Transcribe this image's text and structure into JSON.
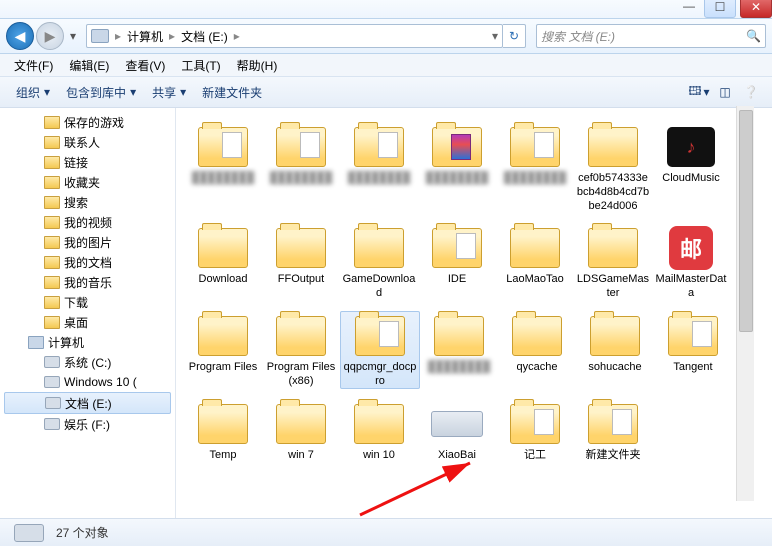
{
  "titlebar": {
    "min": "—",
    "max": "☐",
    "close": "✕"
  },
  "nav": {
    "crumbs": [
      "计算机",
      "文档 (E:)"
    ],
    "search_placeholder": "搜索 文档 (E:)"
  },
  "menubar": [
    "文件(F)",
    "编辑(E)",
    "查看(V)",
    "工具(T)",
    "帮助(H)"
  ],
  "toolbar": {
    "organize": "组织",
    "include": "包含到库中",
    "share": "共享",
    "newfolder": "新建文件夹"
  },
  "sidebar": {
    "items": [
      {
        "label": "保存的游戏",
        "kind": "folder",
        "level": 1
      },
      {
        "label": "联系人",
        "kind": "folder",
        "level": 1
      },
      {
        "label": "链接",
        "kind": "folder",
        "level": 1
      },
      {
        "label": "收藏夹",
        "kind": "folder",
        "level": 1
      },
      {
        "label": "搜索",
        "kind": "folder",
        "level": 1
      },
      {
        "label": "我的视频",
        "kind": "folder",
        "level": 1
      },
      {
        "label": "我的图片",
        "kind": "folder",
        "level": 1
      },
      {
        "label": "我的文档",
        "kind": "folder",
        "level": 1
      },
      {
        "label": "我的音乐",
        "kind": "folder",
        "level": 1
      },
      {
        "label": "下载",
        "kind": "folder",
        "level": 1
      },
      {
        "label": "桌面",
        "kind": "folder",
        "level": 1
      },
      {
        "label": "计算机",
        "kind": "computer",
        "level": 0
      },
      {
        "label": "系统 (C:)",
        "kind": "drive",
        "level": 1
      },
      {
        "label": "Windows 10 (",
        "kind": "drive",
        "level": 1
      },
      {
        "label": "文档 (E:)",
        "kind": "drive",
        "level": 1,
        "selected": true
      },
      {
        "label": "娱乐 (F:)",
        "kind": "drive",
        "level": 1
      }
    ]
  },
  "files": [
    {
      "kind": "folder-doc",
      "blur": true,
      "name": ""
    },
    {
      "kind": "folder-doc",
      "blur": true,
      "name": ""
    },
    {
      "kind": "folder-doc",
      "blur": true,
      "name": ""
    },
    {
      "kind": "folder-rar",
      "blur": true,
      "name": ""
    },
    {
      "kind": "folder-doc",
      "blur": true,
      "name": ""
    },
    {
      "kind": "folder",
      "name": "cef0b574333ebcb4d8b4cd7bbe24d006"
    },
    {
      "kind": "app-cloud",
      "name": "CloudMusic"
    },
    {
      "kind": "folder",
      "name": "Download"
    },
    {
      "kind": "folder",
      "name": "FFOutput"
    },
    {
      "kind": "folder",
      "name": "GameDownload"
    },
    {
      "kind": "folder-doc",
      "name": "IDE"
    },
    {
      "kind": "folder",
      "name": "LaoMaoTao"
    },
    {
      "kind": "folder",
      "name": "LDSGameMaster"
    },
    {
      "kind": "app-mail",
      "name": "MailMasterData"
    },
    {
      "kind": "folder",
      "name": "Program Files"
    },
    {
      "kind": "folder",
      "name": "Program Files (x86)"
    },
    {
      "kind": "folder-doc",
      "name": "qqpcmgr_docpro",
      "selected": true
    },
    {
      "kind": "folder",
      "blur": true,
      "name": ""
    },
    {
      "kind": "folder",
      "name": "qycache"
    },
    {
      "kind": "folder",
      "name": "sohucache"
    },
    {
      "kind": "folder-doc",
      "name": "Tangent"
    },
    {
      "kind": "folder",
      "name": "Temp"
    },
    {
      "kind": "folder",
      "name": "win 7"
    },
    {
      "kind": "folder",
      "name": "win 10"
    },
    {
      "kind": "disk",
      "name": "XiaoBai"
    },
    {
      "kind": "folder-doc",
      "name": "记工"
    },
    {
      "kind": "folder-doc",
      "name": "新建文件夹"
    }
  ],
  "status": {
    "count_label": "27 个对象"
  },
  "icons": {
    "mail_glyph": "邮",
    "cloud_glyph": "♪"
  }
}
